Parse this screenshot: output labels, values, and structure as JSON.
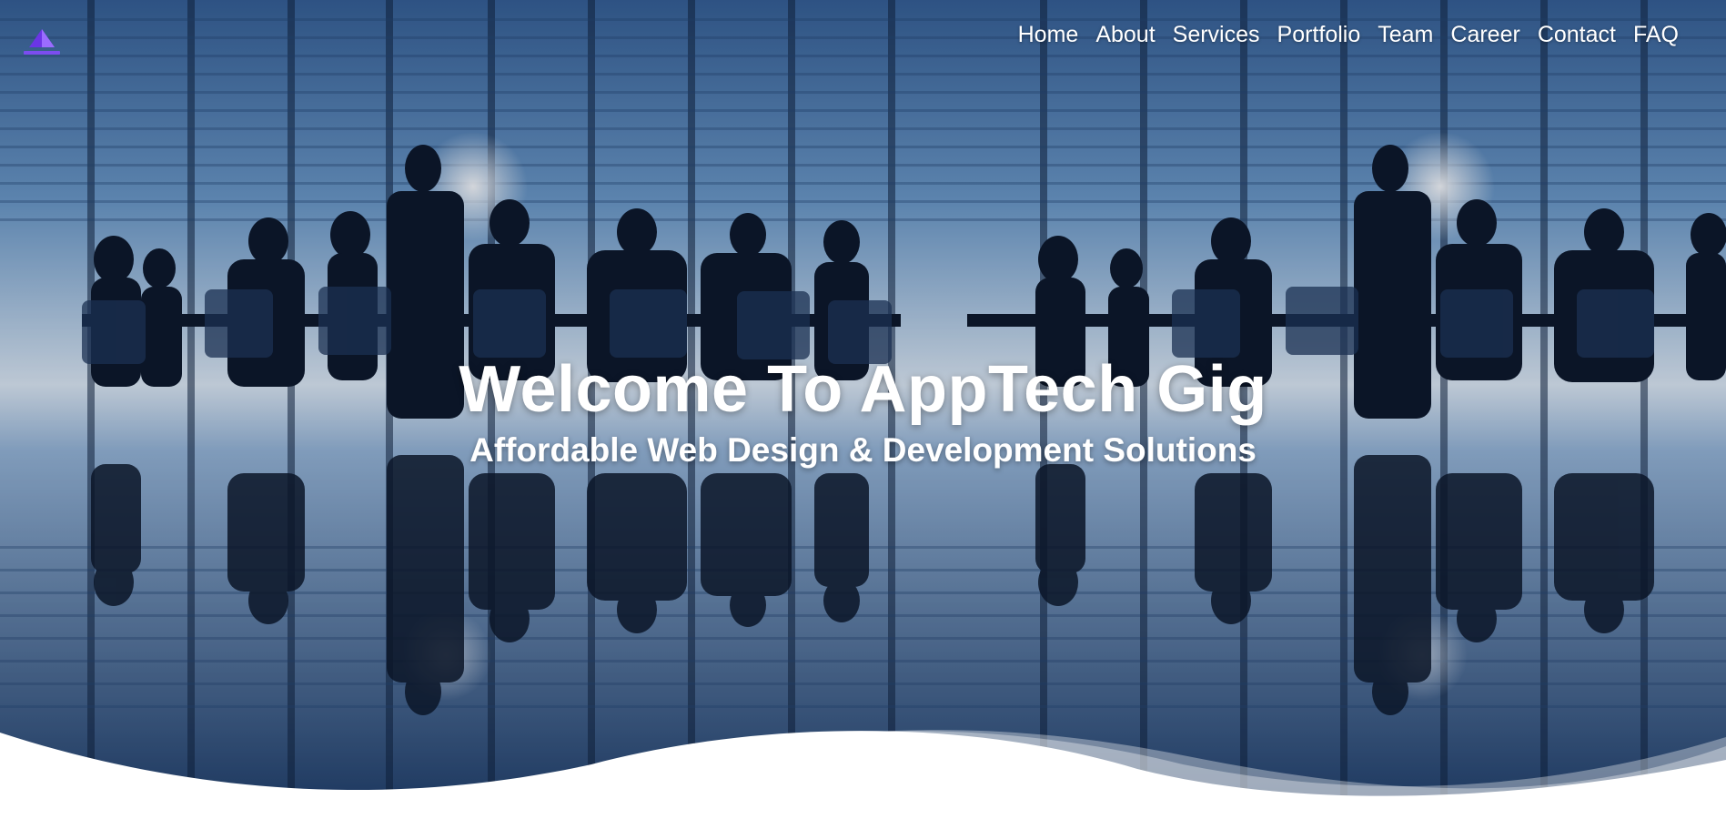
{
  "brand": {
    "logo_icon": "pyramid-logo-icon",
    "logo_color": "#6b35e6"
  },
  "nav": {
    "items": [
      {
        "label": "Home"
      },
      {
        "label": "About"
      },
      {
        "label": "Services"
      },
      {
        "label": "Portfolio"
      },
      {
        "label": "Team"
      },
      {
        "label": "Career"
      },
      {
        "label": "Contact"
      },
      {
        "label": "FAQ"
      }
    ]
  },
  "hero": {
    "title": "Welcome To AppTech Gig",
    "subtitle": "Affordable Web Design & Development Solutions",
    "background_image": "business-meeting-silhouettes-photo"
  },
  "colors": {
    "text": "#ffffff",
    "sky_light": "#dbe7f3",
    "sky_dark": "#203e69",
    "wave": "#ffffff"
  }
}
